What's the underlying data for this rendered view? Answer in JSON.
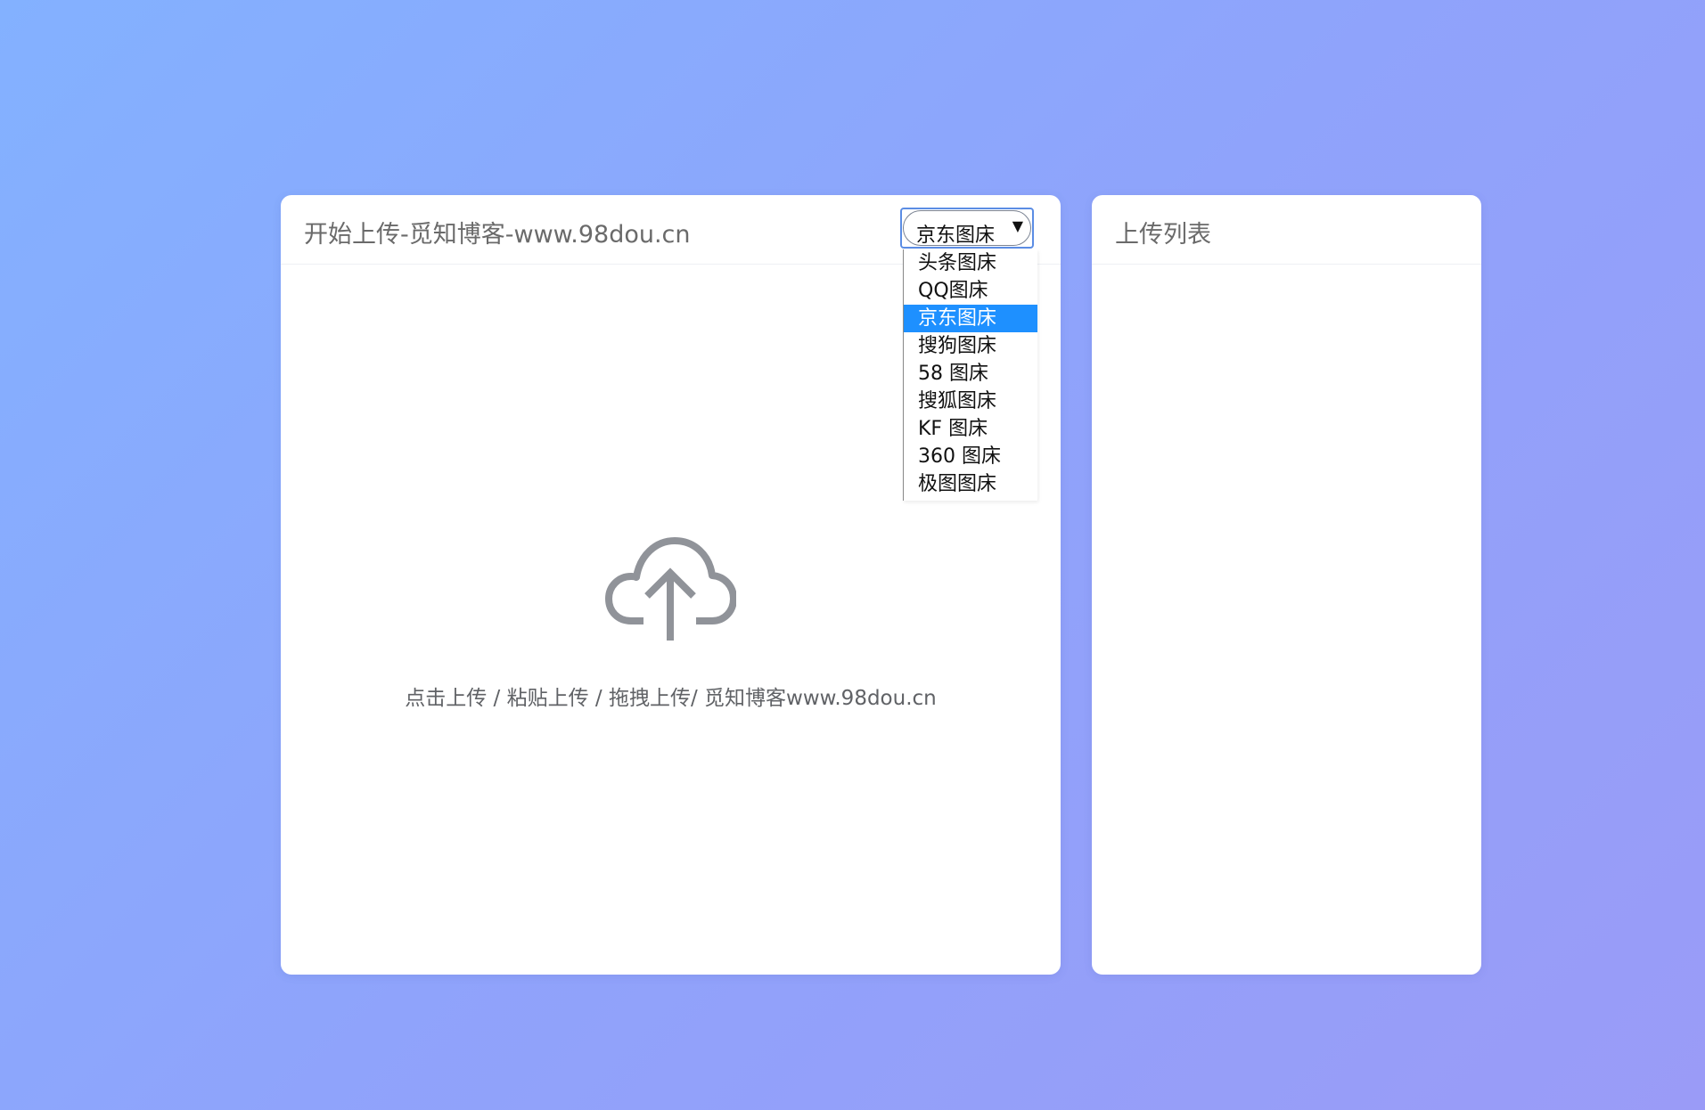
{
  "upload_panel": {
    "title": "开始上传-觅知博客-www.98dou.cn",
    "host_select": {
      "selected": "京东图床",
      "arrow": "▼",
      "options": [
        "头条图床",
        "QQ图床",
        "京东图床",
        "搜狗图床",
        "58 图床",
        "搜狐图床",
        "KF 图床",
        "360 图床",
        "极图图床"
      ],
      "highlighted_index": 2
    },
    "upload_icon": "cloud-upload-icon",
    "hint": "点击上传 / 粘贴上传 / 拖拽上传/ 觅知博客www.98dou.cn"
  },
  "list_panel": {
    "title": "上传列表"
  },
  "colors": {
    "background_start": "#83b1ff",
    "background_end": "#9a9bf7",
    "highlight": "#1e90ff",
    "icon": "#909399"
  }
}
